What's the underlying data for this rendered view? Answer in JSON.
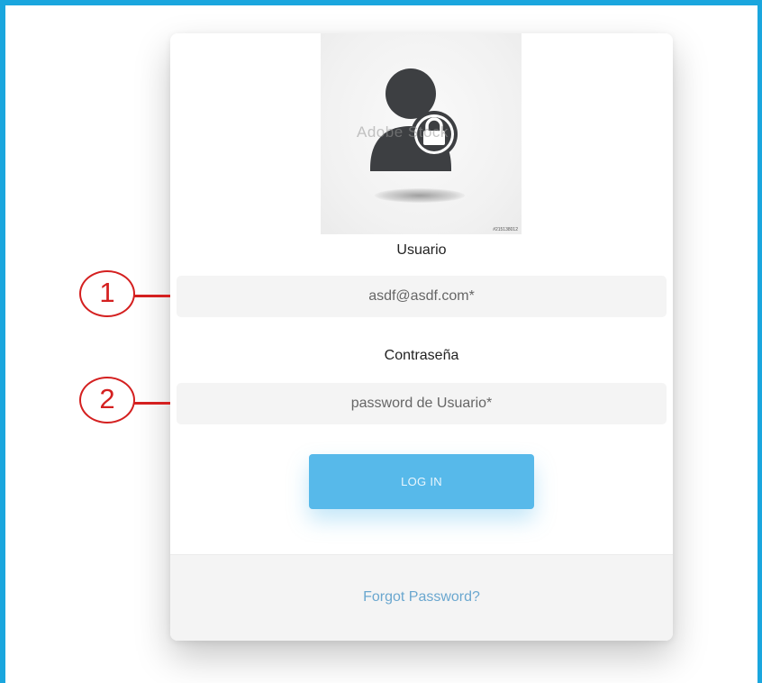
{
  "login": {
    "avatar": {
      "icon": "user-lock-icon",
      "watermark": "Adobe Stock",
      "stock_id": "#215138012"
    },
    "username": {
      "label": "Usuario",
      "placeholder": "asdf@asdf.com*"
    },
    "password": {
      "label": "Contraseña",
      "placeholder": "password de Usuario*"
    },
    "login_button": "LOG IN",
    "forgot_password": "Forgot Password?"
  },
  "callouts": [
    {
      "number": "1"
    },
    {
      "number": "2"
    }
  ],
  "colors": {
    "frame_border": "#1aa6de",
    "button": "#57b9ea",
    "link": "#6aa7cf",
    "callout": "#d42020"
  }
}
